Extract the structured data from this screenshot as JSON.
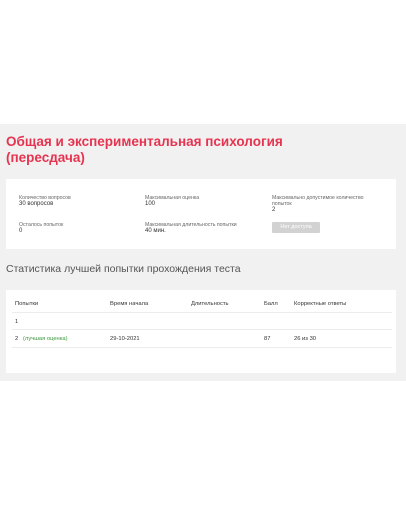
{
  "title": "Общая и экспериментальная психология (пересдача)",
  "info": {
    "questions_label": "Количество вопросов",
    "questions_value": "30 вопросов",
    "max_score_label": "Максимальная оценка",
    "max_score_value": "100",
    "max_attempts_label": "Максимально допустимое количество попыток",
    "max_attempts_value": "2",
    "attempts_left_label": "Осталось попыток",
    "attempts_left_value": "0",
    "max_duration_label": "Максимальная длительность попытки",
    "max_duration_value": "40 мин.",
    "button_label": "Нет доступа"
  },
  "stats": {
    "title": "Статистика лучшей попытки прохождения теста",
    "columns": [
      "Попытки",
      "Время начала",
      "Длительность",
      "Балл",
      "Корректные ответы"
    ],
    "rows": [
      {
        "attempt": "1",
        "best_label": "",
        "start": "",
        "duration": "",
        "score": "",
        "correct": ""
      },
      {
        "attempt": "2",
        "best_label": "(лучшая оценка)",
        "start": "29-10-2021",
        "duration": "",
        "score": "87",
        "correct": "26 из 30"
      }
    ]
  }
}
